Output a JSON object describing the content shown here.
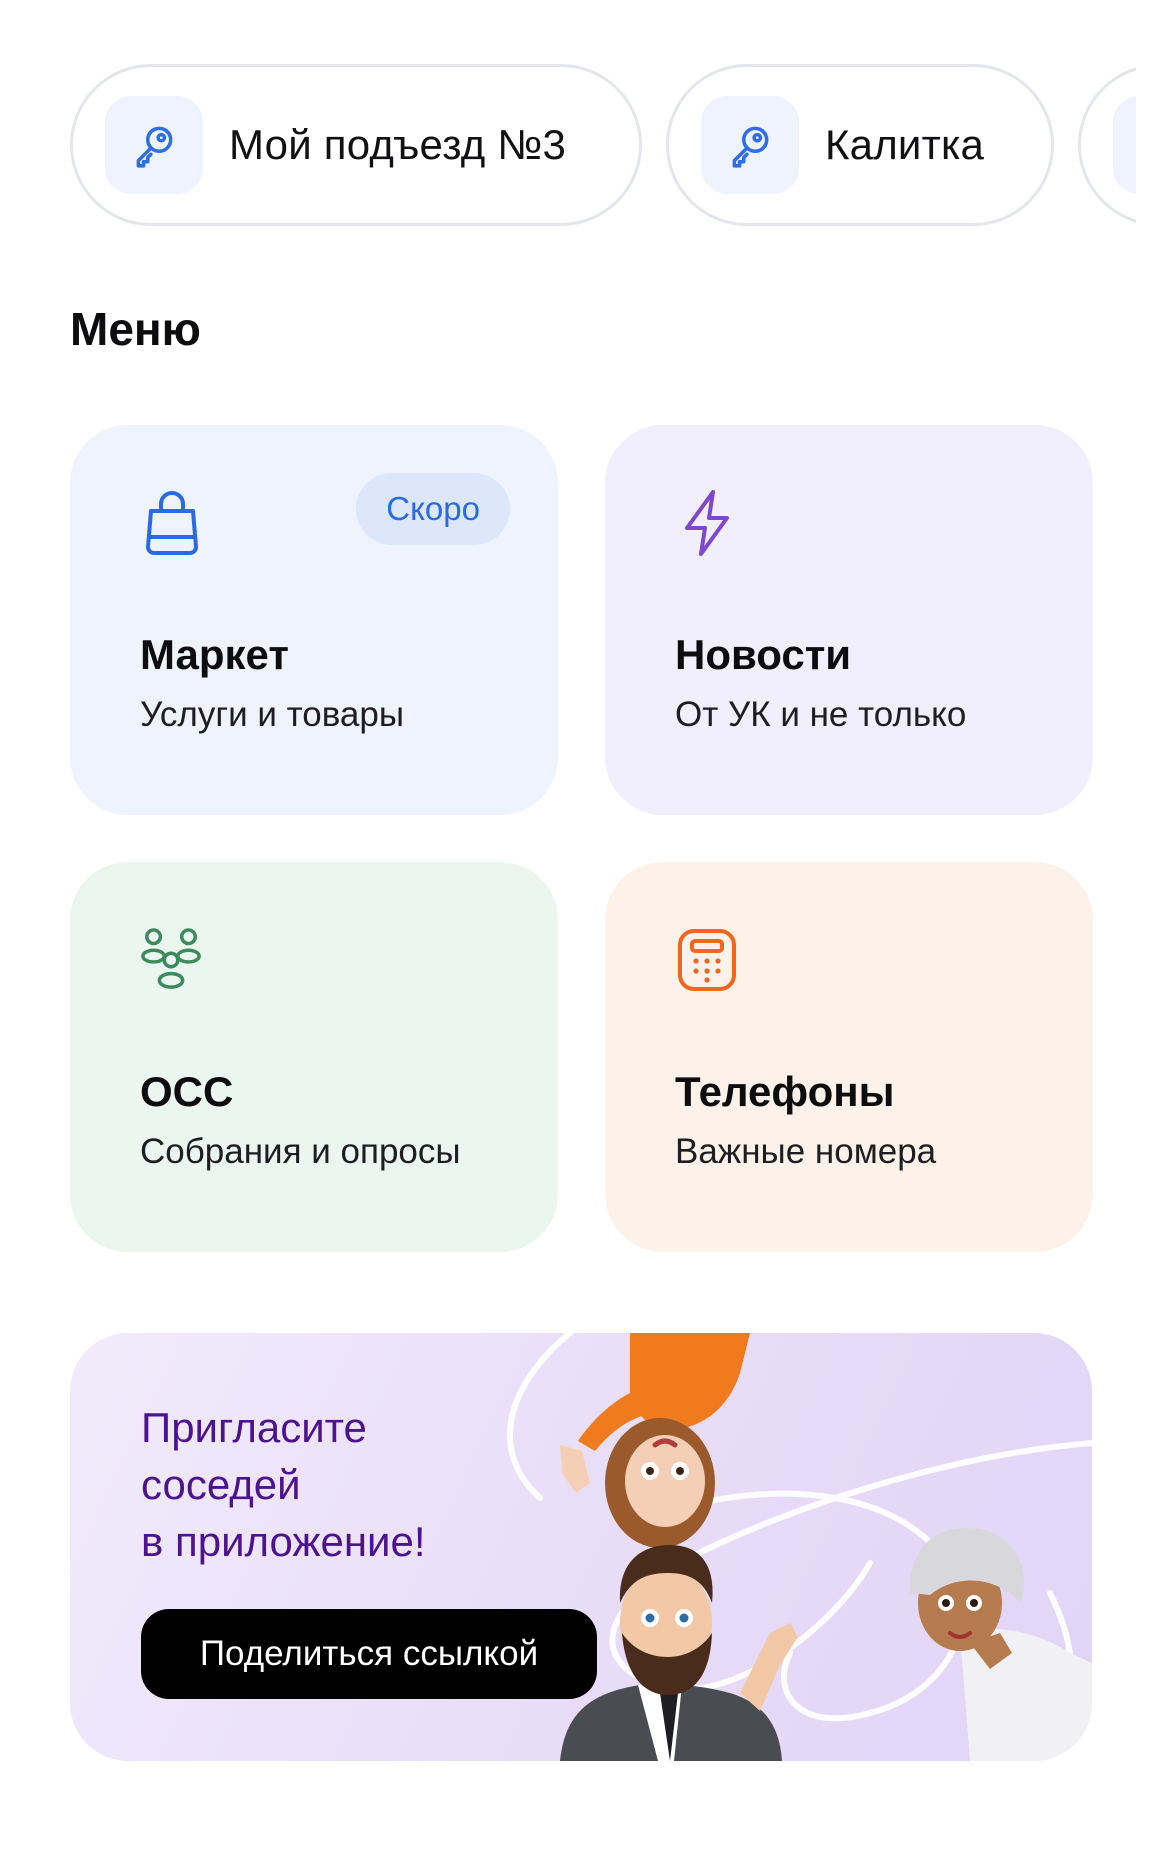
{
  "access": {
    "items": [
      {
        "label": "Мой подъезд №3",
        "icon": "key-icon"
      },
      {
        "label": "Калитка",
        "icon": "key-icon"
      },
      {
        "label": "",
        "icon": "key-icon"
      }
    ]
  },
  "menu": {
    "title": "Меню",
    "tiles": [
      {
        "title": "Маркет",
        "subtitle": "Услуги и товары",
        "badge": "Скоро",
        "icon": "shopping-bag-icon",
        "accent": "#2a6ae8"
      },
      {
        "title": "Новости",
        "subtitle": "От УК и не только",
        "icon": "lightning-icon",
        "accent": "#7e47cf"
      },
      {
        "title": "ОСС",
        "subtitle": "Собрания и опросы",
        "icon": "people-group-icon",
        "accent": "#3d8a5d"
      },
      {
        "title": "Телефоны",
        "subtitle": "Важные номера",
        "icon": "phone-keypad-icon",
        "accent": "#f2661d"
      }
    ]
  },
  "invite": {
    "title_lines": [
      "Пригласите",
      "соседей",
      "в приложение!"
    ],
    "button_label": "Поделиться ссылкой",
    "title_color": "#4d138f"
  }
}
